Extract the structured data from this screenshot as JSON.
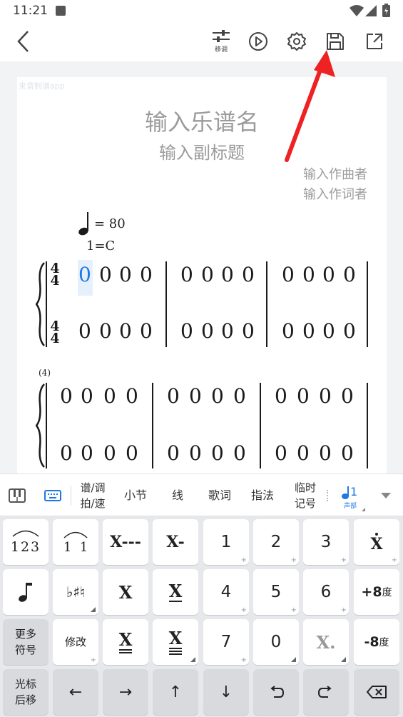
{
  "status": {
    "time": "11:21"
  },
  "toolbar": {
    "transpose_label": "移调"
  },
  "score": {
    "watermark": "来音制谱app",
    "title_placeholder": "输入乐谱名",
    "subtitle_placeholder": "输入副标题",
    "composer_placeholder": "输入作曲者",
    "lyricist_placeholder": "输入作词者",
    "tempo": "= 80",
    "key": "1=C",
    "time_sig_top": "4",
    "time_sig_bottom": "4",
    "measure_number": "(4)",
    "rest": "0",
    "cursor_note": "0"
  },
  "tabs": {
    "staff_key": "谱/调",
    "beat_speed": "拍/速",
    "measure": "小节",
    "line": "线",
    "lyrics": "歌词",
    "fingering": "指法",
    "accidental_1": "临时",
    "accidental_2": "记号",
    "voice_num": "1",
    "voice_label": "声部"
  },
  "keys": {
    "row1": [
      "123",
      "1  1",
      "X---",
      "X-",
      "1",
      "2",
      "3",
      "X"
    ],
    "row2": [
      "X",
      "X",
      "4",
      "5",
      "6",
      "+8",
      "度"
    ],
    "row3": [
      "更多",
      "符号",
      "修改",
      "X",
      "X",
      "7",
      "0",
      "X.",
      "-8",
      "度"
    ],
    "row4": [
      "光标",
      "后移",
      "←",
      "→",
      "↑",
      "↓",
      "⤺",
      "⤻"
    ]
  },
  "colors": {
    "accent": "#1e78e6",
    "arrow": "#ee2222"
  }
}
